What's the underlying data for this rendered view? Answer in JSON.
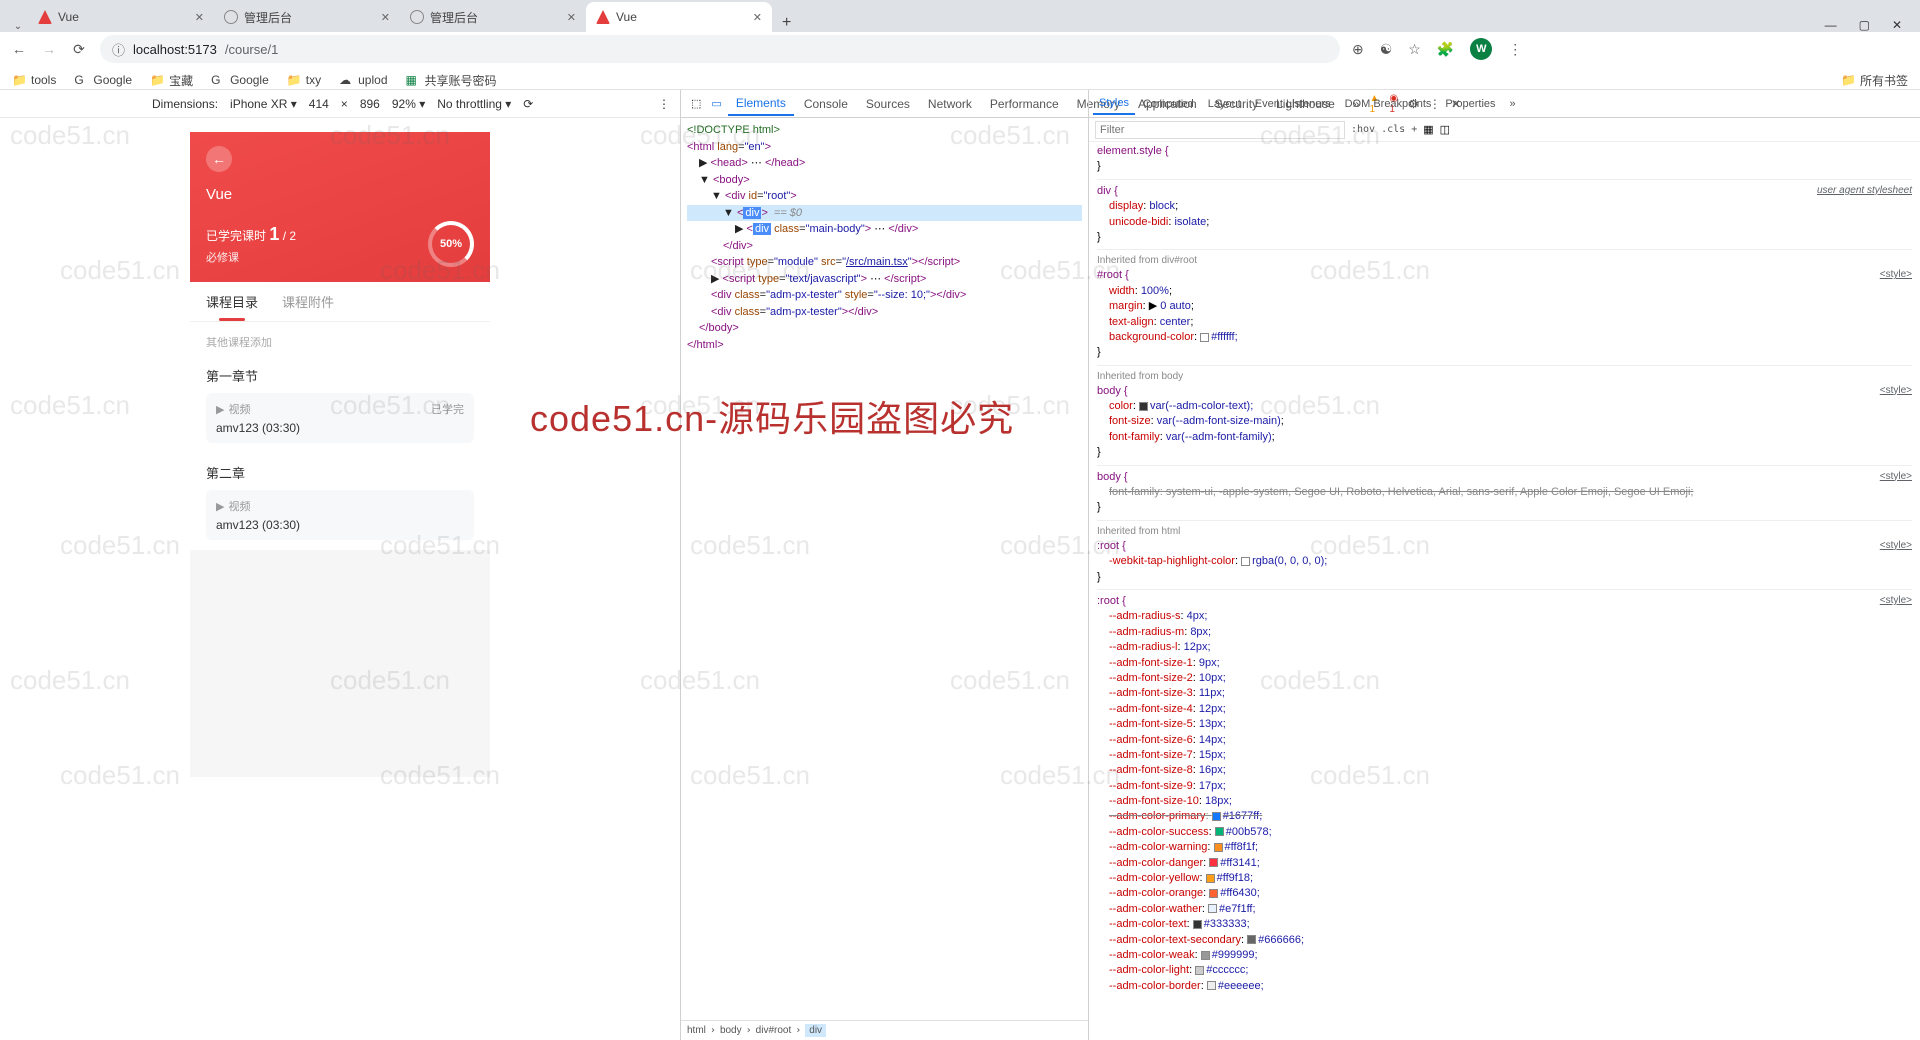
{
  "browser": {
    "tabs": [
      {
        "title": "Vue",
        "favicon_color": "#e43d3d",
        "active": false
      },
      {
        "title": "管理后台",
        "favicon_color": "#777",
        "active": false
      },
      {
        "title": "管理后台",
        "favicon_color": "#777",
        "active": false
      },
      {
        "title": "Vue",
        "favicon_color": "#e43d3d",
        "active": true
      }
    ],
    "url_prefix": "localhost:5173",
    "url_path": "/course/1",
    "avatar_letter": "W",
    "bookmarks": [
      "tools",
      "Google",
      "宝藏",
      "Google",
      "txy",
      "uplod",
      "共享账号密码"
    ],
    "all_bookmarks": "所有书签"
  },
  "device_bar": {
    "dimensions_label": "Dimensions:",
    "device": "iPhone XR",
    "width": "414",
    "height": "896",
    "zoom": "92%",
    "throttling": "No throttling"
  },
  "app": {
    "title": "Vue",
    "progress_label": "已学完课时",
    "progress_done": "1",
    "progress_total": "2",
    "course_type": "必修课",
    "ring_pct": "50%",
    "tab_catalog": "课程目录",
    "tab_attach": "课程附件",
    "other_course": "其他课程添加",
    "chapters": [
      {
        "title": "第一章节",
        "media_label": "视频",
        "status": "已学完",
        "lesson": "amv123 (03:30)"
      },
      {
        "title": "第二章",
        "media_label": "视频",
        "status": "",
        "lesson": "amv123 (03:30)"
      }
    ]
  },
  "devtools": {
    "tabs": [
      "Elements",
      "Console",
      "Sources",
      "Network",
      "Performance",
      "Memory",
      "Application",
      "Security",
      "Lighthouse"
    ],
    "active_tab": "Elements",
    "warn_count": "1",
    "err_count": "1",
    "dom": {
      "doctype": "<!DOCTYPE html>",
      "html_open": "<html lang=\"en\">",
      "head": "<head> … </head>",
      "body_open": "<body>",
      "root_open": "<div id=\"root\">",
      "div_sel": "<div>",
      "sel_eq": "== $0",
      "main_body": "<div class=\"main-body\"> … </div>",
      "div_close": "</div>",
      "script1": "<script type=\"module\" src=\"/src/main.tsx\"></script>",
      "script1_link": "/src/main.tsx",
      "script2": "<script type=\"text/javascript\"> … </script>",
      "tester1": "<div class=\"adm-px-tester\" style=\"--size: 10;\"></div>",
      "tester2": "<div class=\"adm-px-tester\"></div>",
      "body_close": "</body>",
      "html_close": "</html>"
    },
    "breadcrumb": [
      "html",
      "body",
      "div#root",
      "div"
    ]
  },
  "styles": {
    "tabs": [
      "Styles",
      "Computed",
      "Layout",
      "Event Listeners",
      "DOM Breakpoints",
      "Properties"
    ],
    "filter_placeholder": "Filter",
    "toggles": ":hov .cls +",
    "rules": {
      "element_style": "element.style {",
      "div_rule": "div {",
      "div_display": "display: block;",
      "div_bidi": "unicode-bidi: isolate;",
      "ua_label": "user agent stylesheet",
      "inh_root": "Inherited from div#root",
      "root_sel": "#root {",
      "root_width": "width: 100%;",
      "root_margin": "margin: ▶ 0 auto;",
      "root_align": "text-align: center;",
      "root_bg": "background-color: ",
      "root_bg_val": "#ffffff;",
      "inh_body": "Inherited from body",
      "body_sel": "body {",
      "body_color": "color: ",
      "body_color_val": "var(--adm-color-text);",
      "body_fs": "font-size: var(--adm-font-size-main);",
      "body_ff": "font-family: var(--adm-font-family);",
      "body2_ff": "font-family: system-ui, -apple-system, Segoe UI, Roboto, Helvetica, Arial, sans-serif, Apple Color Emoji, Segoe UI Emoji;",
      "inh_html": "Inherited from html",
      "root2_sel": ":root {",
      "tap_hl": "-webkit-tap-highlight-color: ",
      "tap_hl_val": "rgba(0, 0, 0, 0);",
      "vars": [
        {
          "k": "--adm-radius-s",
          "v": "4px;"
        },
        {
          "k": "--adm-radius-m",
          "v": "8px;"
        },
        {
          "k": "--adm-radius-l",
          "v": "12px;"
        },
        {
          "k": "--adm-font-size-1",
          "v": "9px;"
        },
        {
          "k": "--adm-font-size-2",
          "v": "10px;"
        },
        {
          "k": "--adm-font-size-3",
          "v": "11px;"
        },
        {
          "k": "--adm-font-size-4",
          "v": "12px;"
        },
        {
          "k": "--adm-font-size-5",
          "v": "13px;"
        },
        {
          "k": "--adm-font-size-6",
          "v": "14px;"
        },
        {
          "k": "--adm-font-size-7",
          "v": "15px;"
        },
        {
          "k": "--adm-font-size-8",
          "v": "16px;"
        },
        {
          "k": "--adm-font-size-9",
          "v": "17px;"
        },
        {
          "k": "--adm-font-size-10",
          "v": "18px;"
        }
      ],
      "color_vars": [
        {
          "k": "--adm-color-primary",
          "v": "#1677ff;",
          "c": "#1677ff",
          "strike": true
        },
        {
          "k": "--adm-color-success",
          "v": "#00b578;",
          "c": "#00b578"
        },
        {
          "k": "--adm-color-warning",
          "v": "#ff8f1f;",
          "c": "#ff8f1f"
        },
        {
          "k": "--adm-color-danger",
          "v": "#ff3141;",
          "c": "#ff3141"
        },
        {
          "k": "--adm-color-yellow",
          "v": "#ff9f18;",
          "c": "#ff9f18"
        },
        {
          "k": "--adm-color-orange",
          "v": "#ff6430;",
          "c": "#ff6430"
        },
        {
          "k": "--adm-color-wather",
          "v": "#e7f1ff;",
          "c": "#e7f1ff"
        },
        {
          "k": "--adm-color-text",
          "v": "#333333;",
          "c": "#333333"
        },
        {
          "k": "--adm-color-text-secondary",
          "v": "#666666;",
          "c": "#666666"
        },
        {
          "k": "--adm-color-weak",
          "v": "#999999;",
          "c": "#999999"
        },
        {
          "k": "--adm-color-light",
          "v": "#cccccc;",
          "c": "#cccccc"
        },
        {
          "k": "--adm-color-border",
          "v": "#eeeeee;",
          "c": "#eeeeee"
        }
      ],
      "style_link": "<style>"
    }
  },
  "watermark": {
    "text": "code51.cn",
    "big": "code51.cn-源码乐园盗图必究"
  }
}
